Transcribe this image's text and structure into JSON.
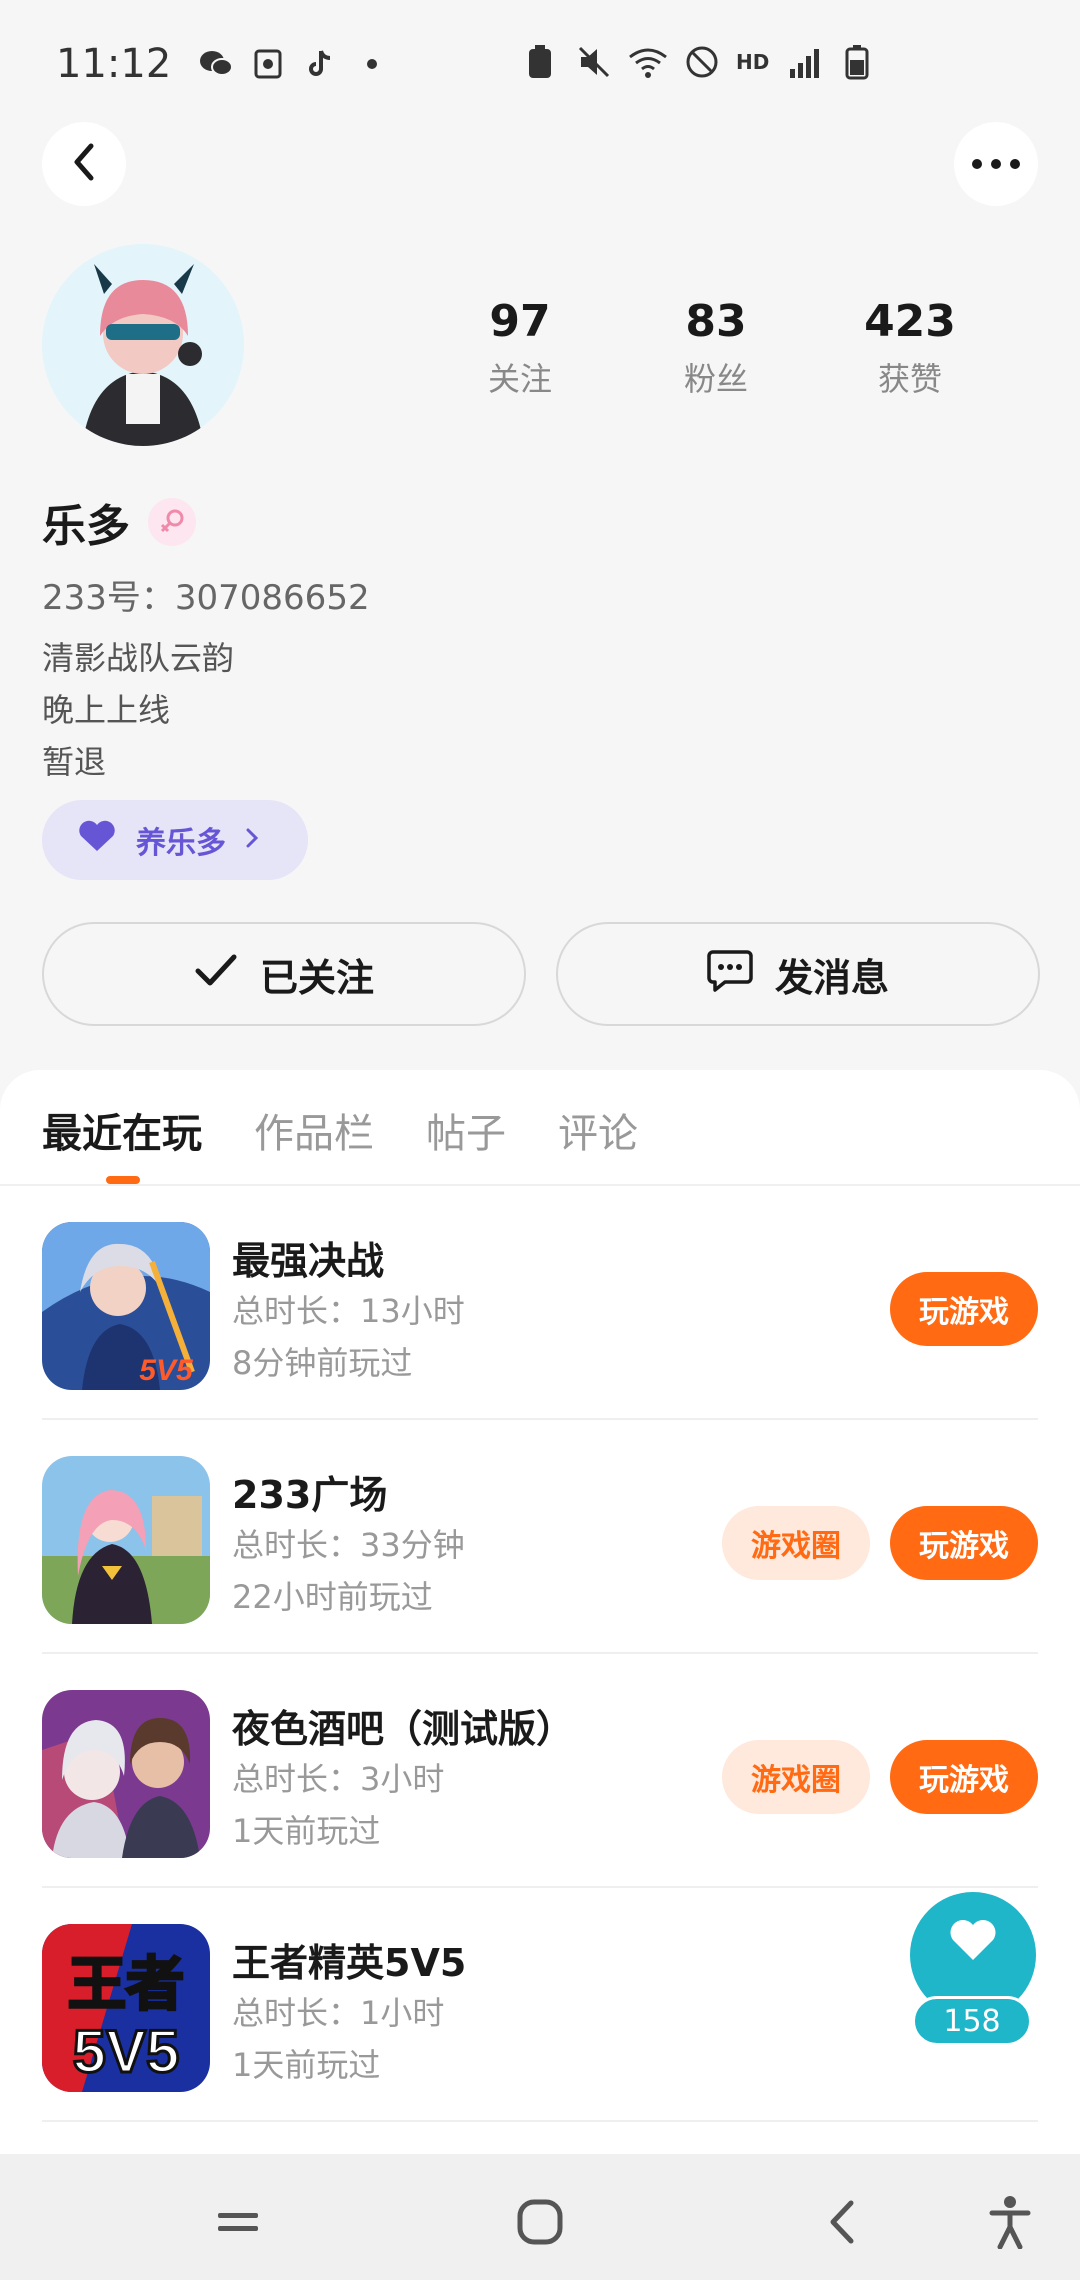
{
  "status_bar": {
    "time": "11:12",
    "left_icons": [
      "wechat-icon",
      "photo-icon",
      "tiktok-icon",
      "dot-icon"
    ],
    "right_icons": [
      "battery-saver-icon",
      "mute-icon",
      "wifi-icon",
      "no-disturb-icon",
      "hd-icon",
      "signal-icon",
      "battery-icon"
    ],
    "hd_label": "HD"
  },
  "header": {
    "back_icon": "chevron-left-icon",
    "more_icon": "more-dots-icon"
  },
  "profile": {
    "stats": [
      {
        "value": "97",
        "label": "关注"
      },
      {
        "value": "83",
        "label": "粉丝"
      },
      {
        "value": "423",
        "label": "获赞"
      }
    ],
    "name": "乐多",
    "gender_icon": "female-icon",
    "uid": "233号：307086652",
    "bio_lines": [
      "清影战队云韵",
      "晚上上线",
      "暂退"
    ],
    "raise_chip_label": "养乐多",
    "follow_label": "已关注",
    "message_label": "发消息"
  },
  "tabs": {
    "items": [
      "最近在玩",
      "作品栏",
      "帖子",
      "评论"
    ],
    "active_index": 0
  },
  "games": [
    {
      "name": "最强决战",
      "duration": "总时长：13小时",
      "last_played": "8分钟前玩过",
      "circle_label": "",
      "play_label": "玩游戏"
    },
    {
      "name": "233广场",
      "duration": "总时长：33分钟",
      "last_played": "22小时前玩过",
      "circle_label": "游戏圈",
      "play_label": "玩游戏"
    },
    {
      "name": "夜色酒吧（测试版）",
      "duration": "总时长：3小时",
      "last_played": "1天前玩过",
      "circle_label": "游戏圈",
      "play_label": "玩游戏"
    },
    {
      "name": "王者精英5V5",
      "duration": "总时长：1小时",
      "last_played": "1天前玩过",
      "circle_label": "",
      "play_label": ""
    }
  ],
  "game_icon_texts": {
    "game1_badge": "5V5",
    "game4_line1": "王者",
    "game4_line2": "5V5"
  },
  "like_fab": {
    "count": "158"
  },
  "colors": {
    "accent": "#ff6a13",
    "fab": "#1fb6c9",
    "chip_purple": "#6656d6"
  }
}
